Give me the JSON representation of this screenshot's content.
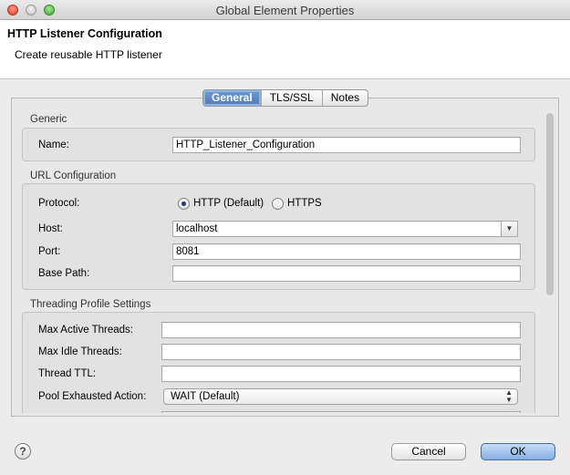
{
  "window": {
    "title": "Global Element Properties"
  },
  "header": {
    "title": "HTTP Listener Configuration",
    "description": "Create reusable HTTP listener"
  },
  "tabs": [
    {
      "label": "General",
      "active": true
    },
    {
      "label": "TLS/SSL",
      "active": false
    },
    {
      "label": "Notes",
      "active": false
    }
  ],
  "generic": {
    "section_title": "Generic",
    "name_label": "Name:",
    "name_value": "HTTP_Listener_Configuration"
  },
  "url": {
    "section_title": "URL Configuration",
    "protocol_label": "Protocol:",
    "protocol_options": [
      "HTTP (Default)",
      "HTTPS"
    ],
    "protocol_selected": "HTTP (Default)",
    "host_label": "Host:",
    "host_value": "localhost",
    "port_label": "Port:",
    "port_value": "8081",
    "base_path_label": "Base Path:",
    "base_path_value": ""
  },
  "threading": {
    "section_title": "Threading Profile Settings",
    "max_active_label": "Max Active Threads:",
    "max_active_value": "",
    "max_idle_label": "Max Idle Threads:",
    "max_idle_value": "",
    "ttl_label": "Thread TTL:",
    "ttl_value": "",
    "pool_exhausted_label": "Pool Exhausted Action:",
    "pool_exhausted_value": "WAIT (Default)"
  },
  "footer": {
    "help_symbol": "?",
    "cancel_label": "Cancel",
    "ok_label": "OK"
  },
  "icons": {
    "close": "close-icon",
    "minimize": "minimize-icon",
    "zoom": "zoom-icon",
    "help": "help-icon",
    "combo": "chevron-down-icon",
    "select": "up-down-arrows-icon"
  },
  "colors": {
    "accent": "#5784c5",
    "ok_button": "#9fc0ec"
  }
}
